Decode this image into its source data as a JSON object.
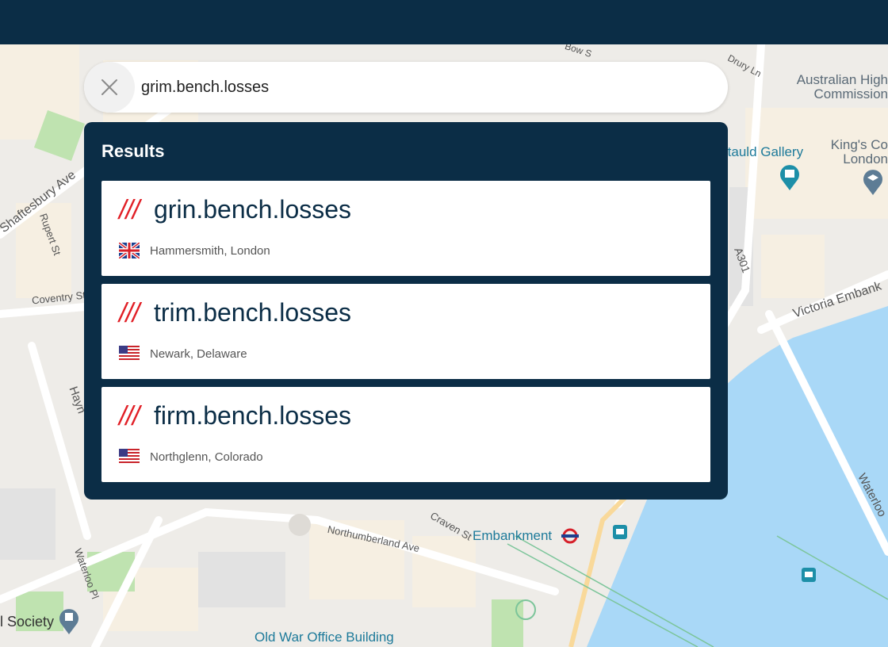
{
  "search": {
    "value": "grim.bench.losses",
    "clear_icon": "close-icon"
  },
  "results": {
    "title": "Results",
    "items": [
      {
        "slashes": "///",
        "words": "grin.bench.losses",
        "place": "Hammersmith, London",
        "flag": "uk-flag-icon"
      },
      {
        "slashes": "///",
        "words": "trim.bench.losses",
        "place": "Newark, Delaware",
        "flag": "us-flag-icon"
      },
      {
        "slashes": "///",
        "words": "firm.bench.losses",
        "place": "Northglenn, Colorado",
        "flag": "us-flag-icon"
      }
    ]
  },
  "map_labels": {
    "australian": "Australian High Commission",
    "courtauld": "rtauld Gallery",
    "kings": "King's Co London",
    "shaftesbury": "Shaftesbury Ave",
    "rupert": "Rupert St",
    "coventry": "Coventry St",
    "a301": "A301",
    "victoria": "Victoria Embank",
    "waterloo": "Waterloo",
    "embankment": "Embankment",
    "northumberland": "Northumberland Ave",
    "craven": "Craven St",
    "waterloo_pl": "Waterloo Pl",
    "society": "l Society",
    "old_war": "Old War Office Building",
    "hay": "Hayn",
    "bow": "Bow S",
    "drury": "Drury Ln"
  },
  "colors": {
    "navy": "#0b2d46",
    "red": "#e11f26",
    "water": "#a9d8f7"
  }
}
